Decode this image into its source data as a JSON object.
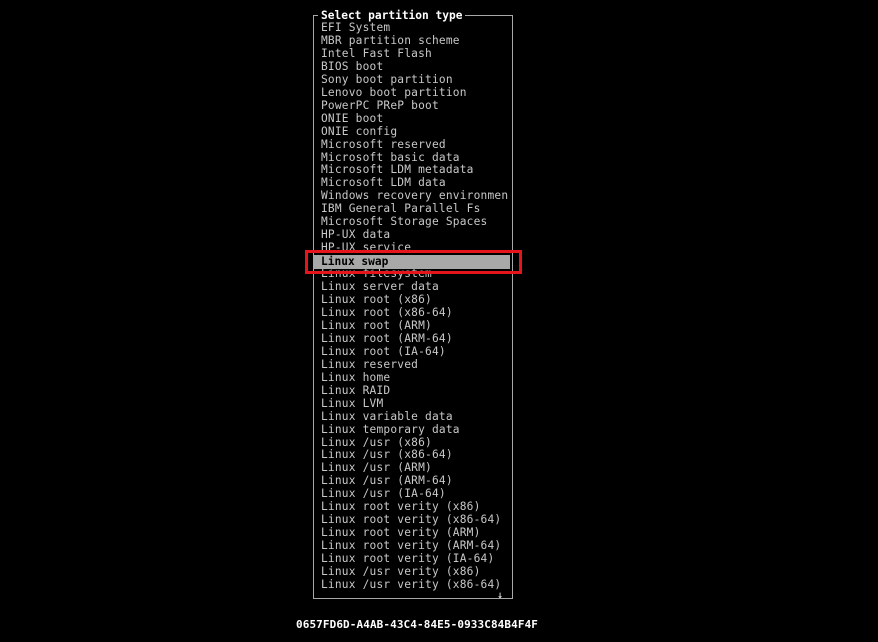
{
  "dialog": {
    "title": "Select partition type",
    "items": [
      "EFI System",
      "MBR partition scheme",
      "Intel Fast Flash",
      "BIOS boot",
      "Sony boot partition",
      "Lenovo boot partition",
      "PowerPC PReP boot",
      "ONIE boot",
      "ONIE config",
      "Microsoft reserved",
      "Microsoft basic data",
      "Microsoft LDM metadata",
      "Microsoft LDM data",
      "Windows recovery environment",
      "IBM General Parallel Fs",
      "Microsoft Storage Spaces",
      "HP-UX data",
      "HP-UX service",
      "Linux swap",
      "Linux filesystem",
      "Linux server data",
      "Linux root (x86)",
      "Linux root (x86-64)",
      "Linux root (ARM)",
      "Linux root (ARM-64)",
      "Linux root (IA-64)",
      "Linux reserved",
      "Linux home",
      "Linux RAID",
      "Linux LVM",
      "Linux variable data",
      "Linux temporary data",
      "Linux /usr (x86)",
      "Linux /usr (x86-64)",
      "Linux /usr (ARM)",
      "Linux /usr (ARM-64)",
      "Linux /usr (IA-64)",
      "Linux root verity (x86)",
      "Linux root verity (x86-64)",
      "Linux root verity (ARM)",
      "Linux root verity (ARM-64)",
      "Linux root verity (IA-64)",
      "Linux /usr verity (x86)",
      "Linux /usr verity (x86-64)"
    ],
    "selected_index": 18,
    "selected_label": "Linux swap",
    "scroll_indicator": "↓"
  },
  "footer": {
    "type_guid": "0657FD6D-A4AB-43C4-84E5-0933C84B4F4F"
  },
  "colors": {
    "background": "#000000",
    "text": "#c8c8c8",
    "selection_bg": "#a8a8a8",
    "highlight_border": "#e8141c"
  }
}
